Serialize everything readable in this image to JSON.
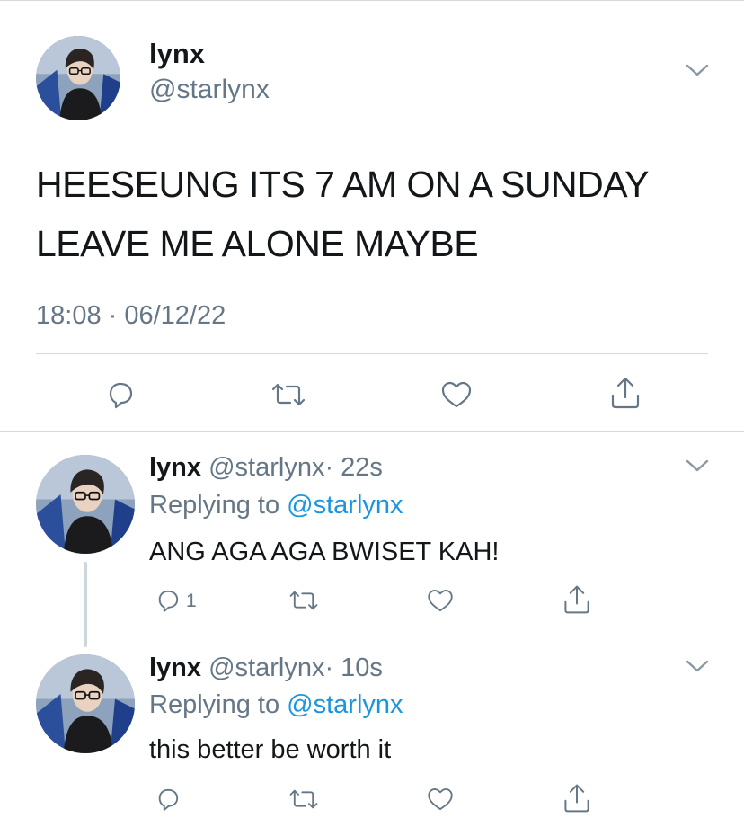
{
  "main_tweet": {
    "name": "lynx",
    "handle": "@starlynx",
    "text_lines": [
      "HEESEUNG ITS 7 AM ON A SUNDAY",
      "LEAVE ME ALONE MAYBE"
    ],
    "timestamp": "18:08 · 06/12/22"
  },
  "replies": [
    {
      "name": "lynx",
      "handle": "@starlynx",
      "time": "· 22s",
      "replying_prefix": "Replying to",
      "replying_to": "@starlynx",
      "text": "ANG AGA AGA BWISET KAH!",
      "reply_count": "1"
    },
    {
      "name": "lynx",
      "handle": "@starlynx",
      "time": "· 10s",
      "replying_prefix": "Replying to",
      "replying_to": "@starlynx",
      "text": "this better be worth it"
    }
  ],
  "icons": [
    "reply-icon",
    "retweet-icon",
    "like-icon",
    "share-icon",
    "chevron-down-icon"
  ],
  "colors": {
    "text": "#14171a",
    "secondary": "#657786",
    "link": "#1b95e0",
    "divider": "#d8d8d8",
    "thread": "#ccd6dd"
  }
}
